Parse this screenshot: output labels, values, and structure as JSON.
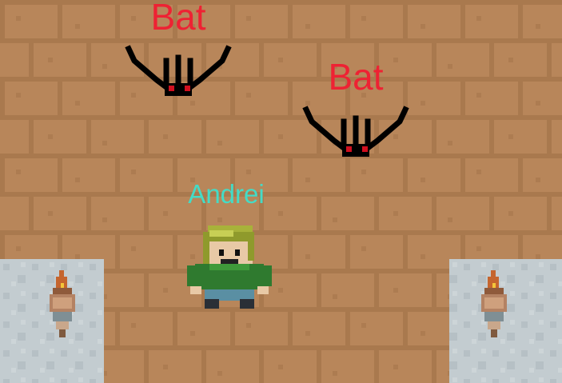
{
  "colors": {
    "floor_base": "#b8865a",
    "floor_dark": "#a9794e",
    "mortar": "#9a6c45",
    "stone": "#c3ccd0",
    "stone_dark": "#b2bcc1",
    "enemy_label": "#ee2233",
    "player_label": "#44dbc6"
  },
  "enemies": [
    {
      "label": "Bat",
      "icon": "bat-sprite"
    },
    {
      "label": "Bat",
      "icon": "bat-sprite"
    }
  ],
  "player": {
    "label": "Andrei",
    "icon": "player-sprite"
  },
  "torches": [
    {
      "icon": "torch-icon"
    },
    {
      "icon": "torch-icon"
    }
  ]
}
